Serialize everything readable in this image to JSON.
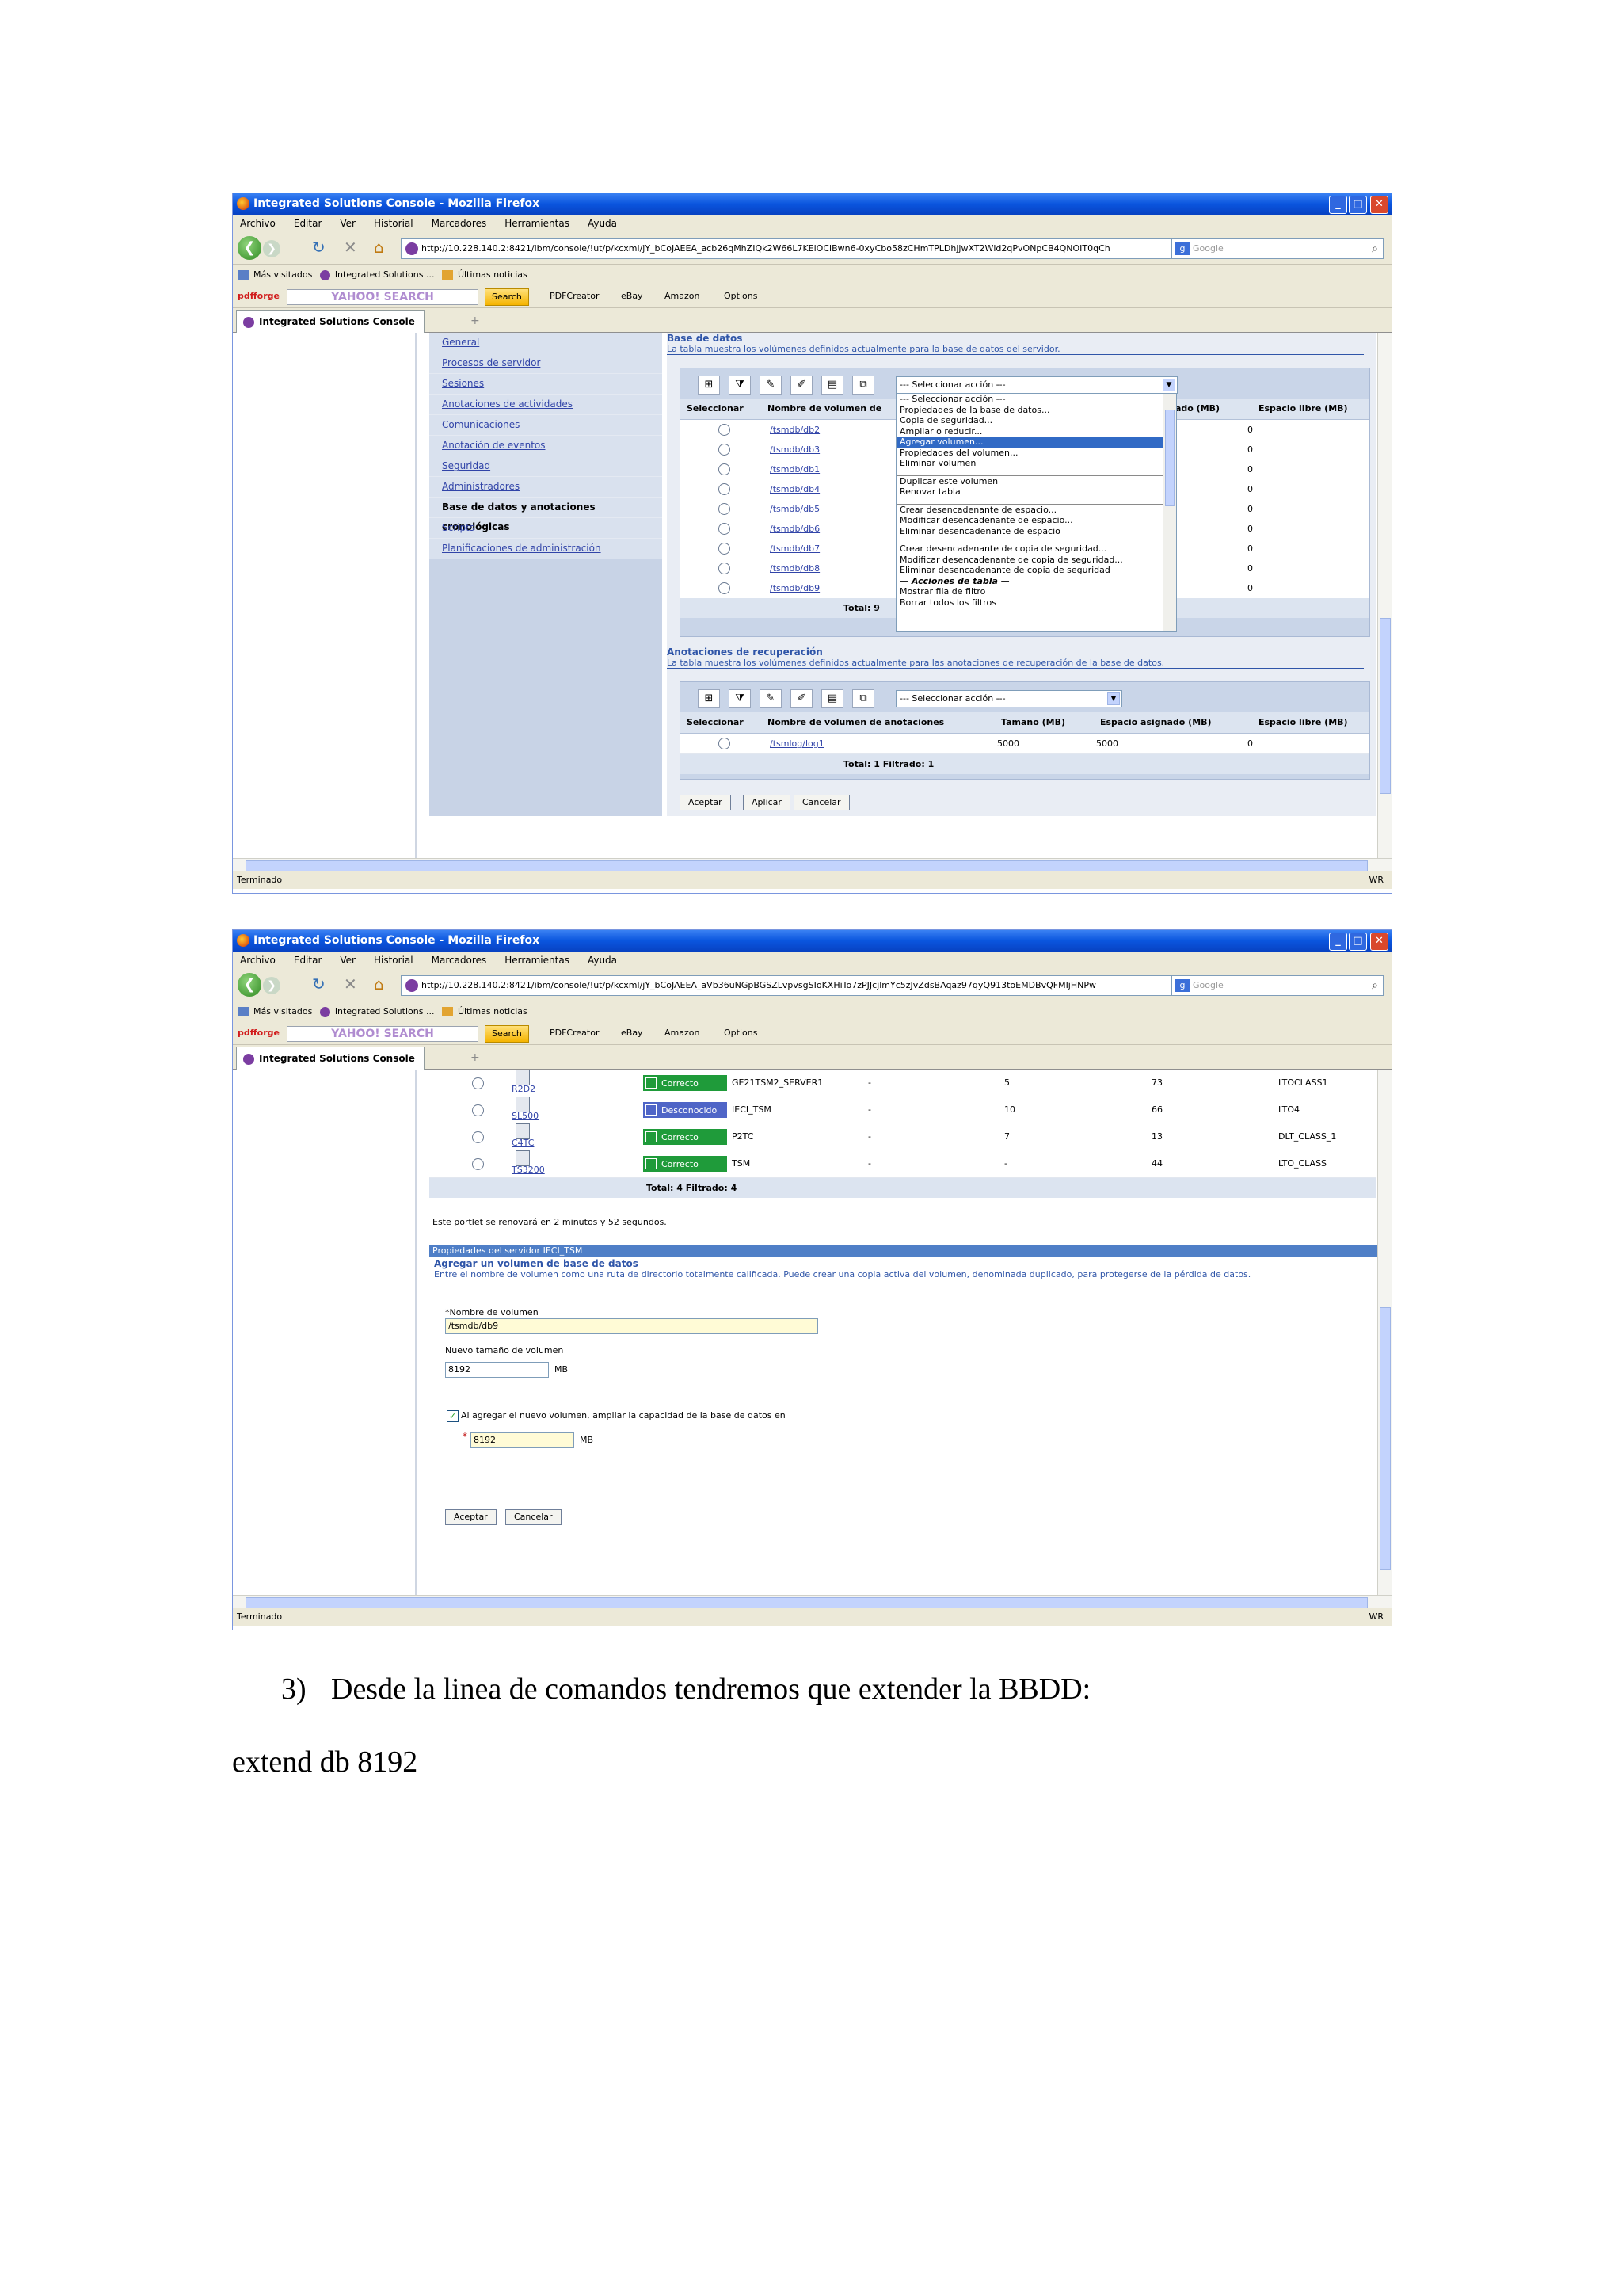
{
  "browser": {
    "menu": [
      "Archivo",
      "Editar",
      "Ver",
      "Historial",
      "Marcadores",
      "Herramientas",
      "Ayuda"
    ],
    "bookmarks": [
      "Más visitados",
      "Integrated Solutions ...",
      "Últimas noticias"
    ],
    "toolbar": {
      "pdfforge": "pdfforge",
      "yahoo": "YAHOO! SEARCH",
      "search_button": "Search",
      "pdfcreator": "PDFCreator",
      "ebay": "eBay",
      "amazon": "Amazon",
      "options": "Options"
    },
    "search_placeholder": "Google",
    "tab_title": "Integrated Solutions Console",
    "status_left": "Terminado",
    "status_right": "WR"
  },
  "screen1": {
    "title": "Integrated Solutions Console - Mozilla Firefox",
    "url": "http://10.228.140.2:8421/ibm/console/!ut/p/kcxml/jY_bCoJAEEA_acb26qMhZIQk2W66L7KEiOClBwn6-0xyCbo58zCHmTPLDhjjwXT2Wld2qPvONpCB4QNOIT0qCh",
    "nav_items": [
      "General",
      "Procesos de servidor",
      "Sesiones",
      "Anotaciones de actividades",
      "Comunicaciones",
      "Anotación de eventos",
      "Seguridad",
      "Administradores",
      "Base de datos y anotaciones cronológicas",
      "Scripts",
      "Planificaciones de administración"
    ],
    "db": {
      "heading": "Base de datos",
      "desc": "La tabla muestra los volúmenes definidos actualmente para la base de datos del servidor.",
      "select_value": "--- Seleccionar acción ---",
      "col_select": "Seleccionar",
      "col_name": "Nombre de volumen de",
      "col_assigned": "ado (MB)",
      "col_free": "Espacio libre (MB)",
      "rows": [
        {
          "name": "/tsmdb/db2",
          "free": "0"
        },
        {
          "name": "/tsmdb/db3",
          "free": "0"
        },
        {
          "name": "/tsmdb/db1",
          "free": "0"
        },
        {
          "name": "/tsmdb/db4",
          "free": "0"
        },
        {
          "name": "/tsmdb/db5",
          "free": "0"
        },
        {
          "name": "/tsmdb/db6",
          "free": "0"
        },
        {
          "name": "/tsmdb/db7",
          "free": "0"
        },
        {
          "name": "/tsmdb/db8",
          "free": "0"
        },
        {
          "name": "/tsmdb/db9",
          "free": "0"
        }
      ],
      "total": "Total: 9",
      "dropdown": [
        "--- Seleccionar acción ---",
        "Propiedades de la base de datos...",
        "Copia de seguridad...",
        "Ampliar o reducir...",
        "Agregar volumen...",
        "Propiedades del volumen...",
        "Eliminar volumen",
        "",
        "Duplicar este volumen",
        "Renovar tabla",
        "",
        "Crear desencadenante de espacio...",
        "Modificar desencadenante de espacio...",
        "Eliminar desencadenante de espacio",
        "",
        "Crear desencadenante de copia de seguridad...",
        "Modificar desencadenante de copia de seguridad...",
        "Eliminar desencadenante de copia de seguridad",
        "— Acciones de tabla —",
        "Mostrar fila de filtro",
        "Borrar todos los filtros"
      ],
      "dropdown_highlight": 4
    },
    "logs": {
      "heading": "Anotaciones de recuperación",
      "desc": "La tabla muestra los volúmenes definidos actualmente para las anotaciones de recuperación de la base de datos.",
      "select_value": "--- Seleccionar acción ---",
      "cols": [
        "Seleccionar",
        "Nombre de volumen de anotaciones",
        "Tamaño (MB)",
        "Espacio asignado (MB)",
        "Espacio libre (MB)"
      ],
      "row": {
        "name": "/tsmlog/log1",
        "size": "5000",
        "assigned": "5000",
        "free": "0"
      },
      "total": "Total: 1   Filtrado: 1"
    },
    "buttons": [
      "Aceptar",
      "Aplicar",
      "Cancelar"
    ]
  },
  "screen2": {
    "title": "Integrated Solutions Console - Mozilla Firefox",
    "url": "http://10.228.140.2:8421/ibm/console/!ut/p/kcxml/jY_bCoJAEEA_aVb36uNGpBGSZLvpvsgSIoKXHiTo7zPJJcjlmYc5zJvZdsBAqaz97qyQ913toEMDBvQFMIjHNPw",
    "servers": [
      {
        "name": "R2D2",
        "status": "Correcto",
        "server": "GE21TSM2_SERVER1",
        "c1": "-",
        "c2": "5",
        "c3": "73",
        "class": "LTOCLASS1",
        "ok": true
      },
      {
        "name": "SL500",
        "status": "Desconocido",
        "server": "IECI_TSM",
        "c1": "-",
        "c2": "10",
        "c3": "66",
        "class": "LTO4",
        "ok": false
      },
      {
        "name": "C4TC",
        "status": "Correcto",
        "server": "P2TC",
        "c1": "-",
        "c2": "7",
        "c3": "13",
        "class": "DLT_CLASS_1",
        "ok": true
      },
      {
        "name": "TS3200",
        "status": "Correcto",
        "server": "TSM",
        "c1": "-",
        "c2": "-",
        "c3": "44",
        "class": "LTO_CLASS",
        "ok": true
      }
    ],
    "total": "Total: 4   Filtrado: 4",
    "refresh_note": "Este portlet se renovará en 2 minutos y 52 segundos.",
    "props_header": "Propiedades del servidor IECI_TSM",
    "form": {
      "heading": "Agregar un volumen de base de datos",
      "desc": "Entre el nombre de volumen como una ruta de directorio totalmente calificada. Puede crear una copia activa del volumen, denominada duplicado, para protegerse de la pérdida de datos.",
      "vol_label": "*Nombre de volumen",
      "vol_value": "/tsmdb/db9",
      "size_label": "Nuevo tamaño de volumen",
      "size_value": "8192",
      "unit": "MB",
      "checkbox_label": "Al agregar el nuevo volumen, ampliar la capacidad de la base de datos en",
      "extend_value": "8192",
      "buttons": [
        "Aceptar",
        "Cancelar"
      ]
    }
  },
  "doc": {
    "step": "3)",
    "step_text": "Desde la linea de comandos tendremos que extender la BBDD:",
    "command": "extend db 8192"
  }
}
